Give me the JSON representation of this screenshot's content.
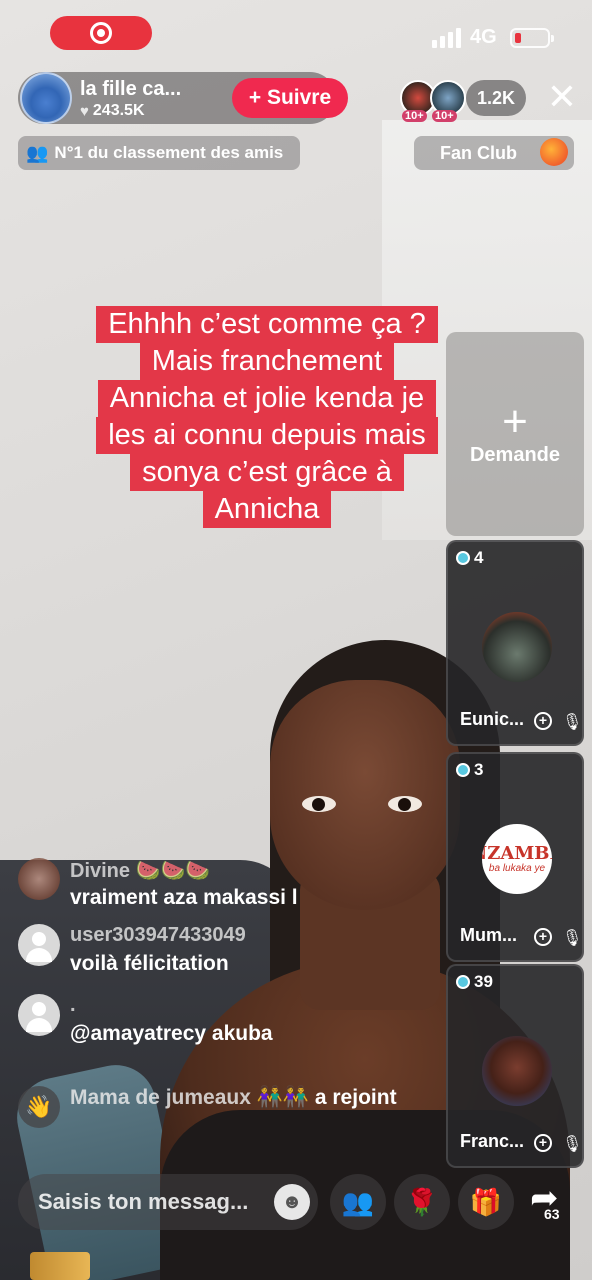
{
  "status_bar": {
    "network": "4G"
  },
  "host": {
    "name": "la fille ca...",
    "likes": "243.5K",
    "follow_label": "+ Suivre"
  },
  "viewers": {
    "badge1": "10+",
    "badge2": "10+",
    "count": "1.2K"
  },
  "rank_banner": "N°1 du classement des amis",
  "fan_club": "Fan Club",
  "caption_lines": [
    "Ehhhh c’est comme ça ?",
    "Mais franchement",
    "Annicha et jolie kenda je",
    "les ai connu depuis mais",
    "sonya c’est grâce à",
    "Annicha"
  ],
  "request_slot": {
    "label": "Demande"
  },
  "guests": [
    {
      "count": "4",
      "name": "Eunic..."
    },
    {
      "count": "3",
      "name": "Mum...",
      "logo_title": "NZAMBE",
      "logo_sub": "ba lukaka ye"
    },
    {
      "count": "39",
      "name": "Franc..."
    }
  ],
  "chat": [
    {
      "user": "Divine 🍉🍉🍉",
      "message": "vraiment aza makassi l"
    },
    {
      "user": "user303947433049",
      "message": "voilà félicitation"
    },
    {
      "user": ".",
      "message": "@amayatrecy akuba"
    },
    {
      "join_user": "Mama de jumeaux 👫👫",
      "join_text": "a rejoint"
    }
  ],
  "input": {
    "placeholder": "Saisis ton messag..."
  },
  "share": {
    "count": "63"
  },
  "icons": {
    "record": "record-icon",
    "heart": "heart-icon",
    "close": "close-icon",
    "people": "people-icon",
    "rose": "rose-gift-icon",
    "gift": "gift-icon",
    "share": "share-arrow-icon",
    "mute": "mic-off-icon"
  }
}
